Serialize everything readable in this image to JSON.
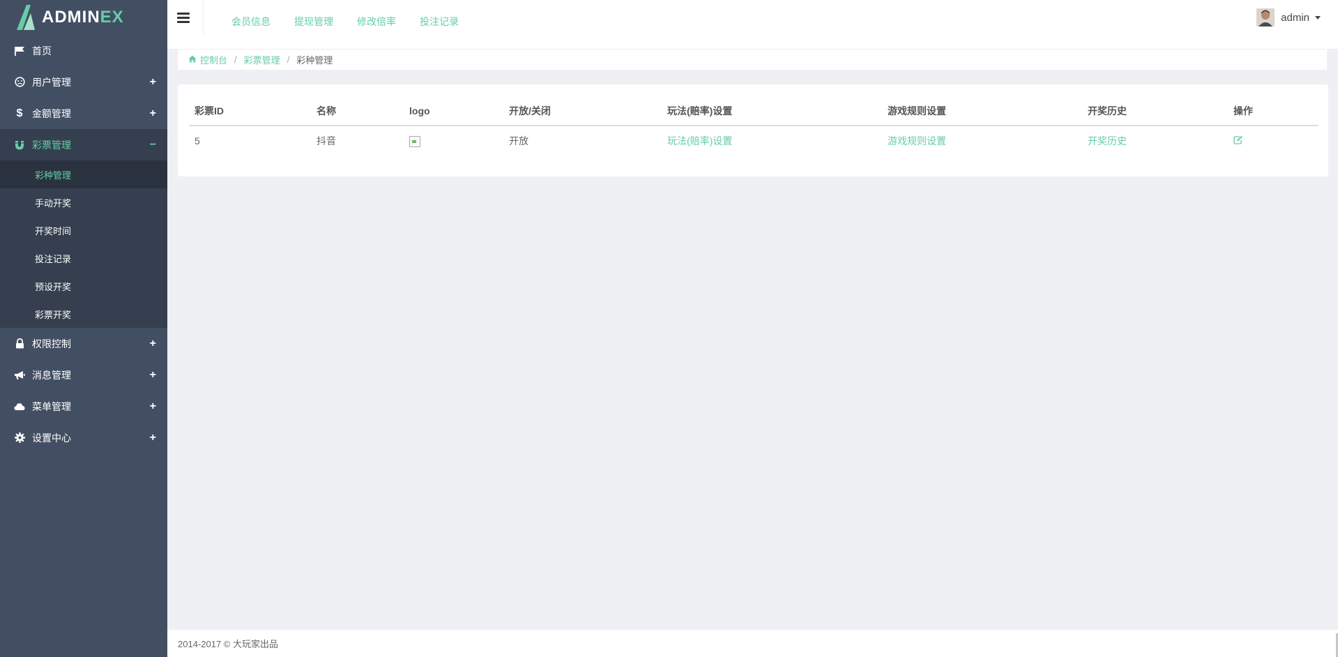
{
  "brand": {
    "prefix": "ADMIN",
    "suffix": "EX"
  },
  "sidebar": {
    "items": [
      {
        "label": "首页",
        "icon": "flag-icon",
        "toggle": ""
      },
      {
        "label": "用户管理",
        "icon": "user-circle-icon",
        "toggle": "+"
      },
      {
        "label": "金额管理",
        "icon": "dollar-icon",
        "toggle": "+"
      },
      {
        "label": "彩票管理",
        "icon": "magnet-icon",
        "toggle": "−"
      },
      {
        "label": "权限控制",
        "icon": "lock-icon",
        "toggle": "+"
      },
      {
        "label": "消息管理",
        "icon": "bullhorn-icon",
        "toggle": "+"
      },
      {
        "label": "菜单管理",
        "icon": "cloud-icon",
        "toggle": "+"
      },
      {
        "label": "设置中心",
        "icon": "gear-icon",
        "toggle": "+"
      }
    ],
    "submenu": [
      "彩种管理",
      "手动开奖",
      "开奖时间",
      "投注记录",
      "预设开奖",
      "彩票开奖"
    ]
  },
  "topnav": [
    "会员信息",
    "提现管理",
    "修改倍率",
    "投注记录"
  ],
  "user": {
    "name": "admin"
  },
  "breadcrumb": {
    "home": "控制台",
    "section": "彩票管理",
    "current": "彩种管理",
    "separator": "/"
  },
  "table": {
    "headers": [
      "彩票ID",
      "名称",
      "logo",
      "开放/关闭",
      "玩法(赔率)设置",
      "游戏规则设置",
      "开奖历史",
      "操作"
    ],
    "rows": [
      {
        "id": "5",
        "name": "抖音",
        "status": "开放",
        "odds_link": "玩法(赔率)设置",
        "rules_link": "游戏规则设置",
        "history_link": "开奖历史"
      }
    ]
  },
  "footer": {
    "text": "2014-2017 © 大玩家出品"
  },
  "colors": {
    "accent": "#65cea7",
    "sidebar": "#424f63",
    "sidebar_active": "#353f4f"
  }
}
